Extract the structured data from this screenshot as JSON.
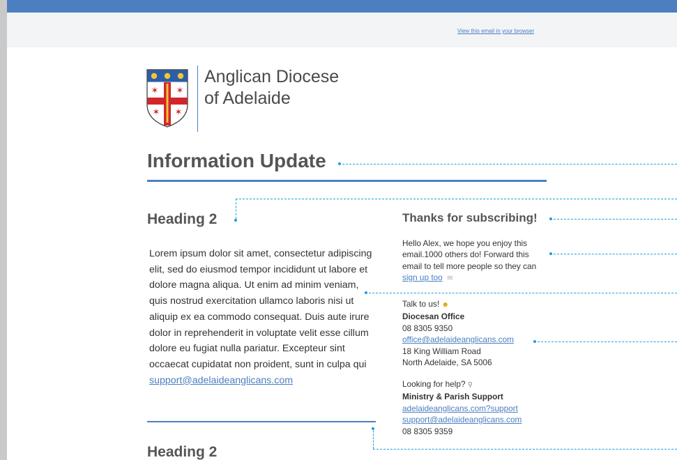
{
  "preheader": {
    "view_in_browser": "View this email in your browser"
  },
  "logo": {
    "line1": "Anglican Diocese",
    "line2": "of Adelaide"
  },
  "colors": {
    "accent": "#4b7fc0",
    "annotation": "#1a9ee0",
    "link": "#4a7fc1"
  },
  "main": {
    "title": "Information Update",
    "heading1": "Heading 2",
    "heading2": "Heading 2",
    "body": "Lorem ipsum dolor sit amet, consectetur adipiscing elit, sed do eiusmod tempor incididunt ut labore et dolore magna aliqua. Ut enim ad minim veniam, quis nostrud exercitation ullamco laboris nisi ut aliquip ex ea commodo consequat. Duis aute irure dolor in reprehenderit in voluptate velit esse cillum dolore eu fugiat nulla pariatur. Excepteur sint occaecat cupidatat non proident, sunt in culpa qui",
    "body_link": "support@adelaideanglicans.com"
  },
  "sidebar": {
    "title": "Thanks for subscribing!",
    "intro_text": "Hello Alex, we hope you enjoy this email.1000 others do! Forward this email to tell more people so they can",
    "signup_link": "sign up too",
    "contact_prompt": "Talk to us!",
    "contact_name": "Diocesan Office",
    "contact_phone": "08 8305 9350",
    "contact_email": "office@adelaideanglicans.com",
    "contact_address1": "18 King William Road",
    "contact_address2": "North Adelaide, SA 5006",
    "help_prompt": "Looking for help?",
    "help_name": "Ministry & Parish Support",
    "help_link": "adelaideanglicans.com?support",
    "help_email": "support@adelaideanglicans.com",
    "help_phone": "08 8305 9359"
  },
  "icons": {
    "smile": "smile-emoji-icon",
    "envelope": "envelope-icon",
    "magnifier": "magnifier-icon"
  }
}
